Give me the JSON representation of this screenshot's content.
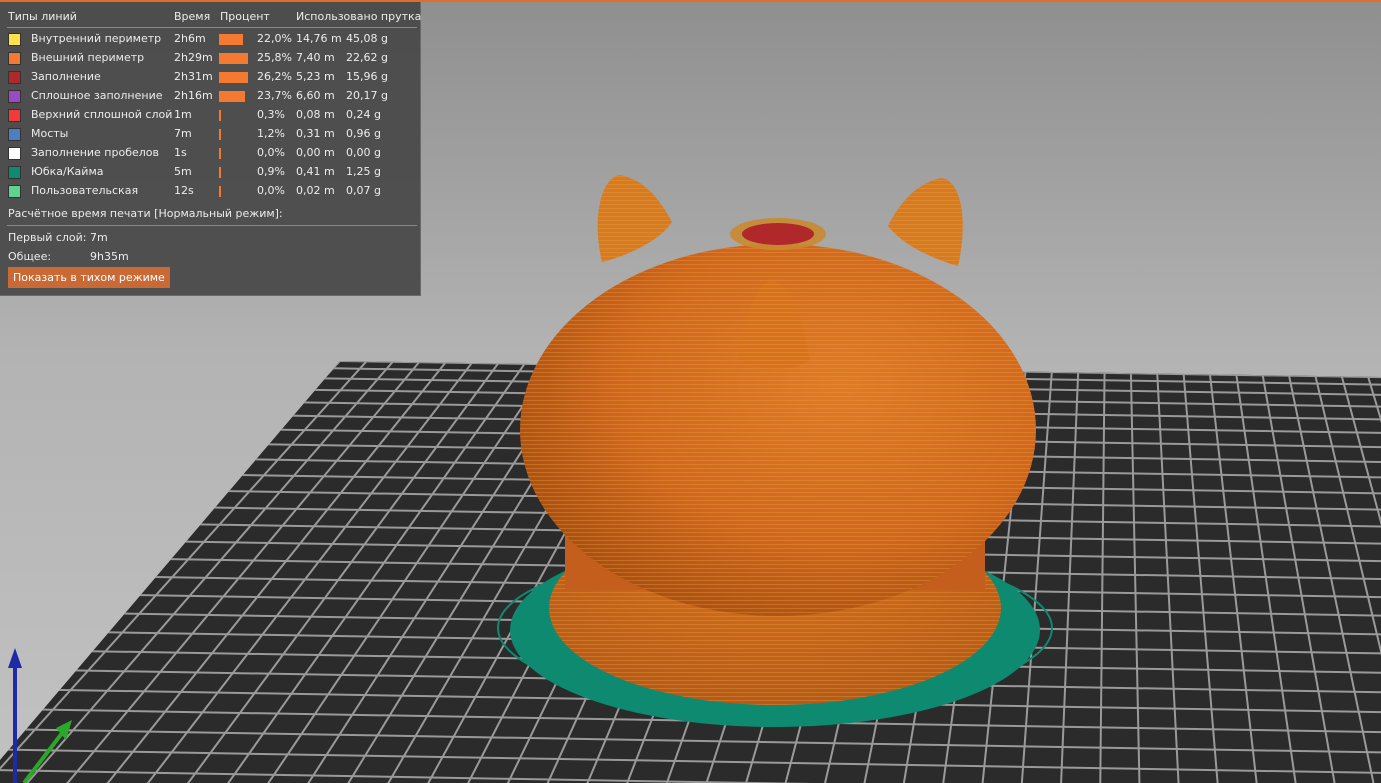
{
  "legend": {
    "headers": {
      "type": "Типы линий",
      "time": "Время",
      "percent": "Процент",
      "used": "Использовано прутка"
    },
    "rows": [
      {
        "label": "Внутренний периметр",
        "color": "#ffe14a",
        "time": "2h6m",
        "percent": "22,0%",
        "pct": 22.0,
        "length": "14,76 m",
        "weight": "45,08 g"
      },
      {
        "label": "Внешний периметр",
        "color": "#f47a32",
        "time": "2h29m",
        "percent": "25,8%",
        "pct": 25.8,
        "length": "7,40 m",
        "weight": "22,62 g"
      },
      {
        "label": "Заполнение",
        "color": "#b0282a",
        "time": "2h31m",
        "percent": "26,2%",
        "pct": 26.2,
        "length": "5,23 m",
        "weight": "15,96 g"
      },
      {
        "label": "Сплошное заполнение",
        "color": "#9a4bc4",
        "time": "2h16m",
        "percent": "23,7%",
        "pct": 23.7,
        "length": "6,60 m",
        "weight": "20,17 g"
      },
      {
        "label": "Верхний сплошной слой",
        "color": "#f23a3a",
        "time": "1m",
        "percent": "0,3%",
        "pct": 0.3,
        "length": "0,08 m",
        "weight": "0,24 g"
      },
      {
        "label": "Мосты",
        "color": "#4b7fc2",
        "time": "7m",
        "percent": "1,2%",
        "pct": 1.2,
        "length": "0,31 m",
        "weight": "0,96 g"
      },
      {
        "label": "Заполнение пробелов",
        "color": "#ffffff",
        "time": "1s",
        "percent": "0,0%",
        "pct": 0.0,
        "length": "0,00 m",
        "weight": "0,00 g"
      },
      {
        "label": "Юбка/Кайма",
        "color": "#0e8a70",
        "time": "5m",
        "percent": "0,9%",
        "pct": 0.9,
        "length": "0,41 m",
        "weight": "1,25 g"
      },
      {
        "label": "Пользовательская",
        "color": "#5ed28f",
        "time": "12s",
        "percent": "0,0%",
        "pct": 0.0,
        "length": "0,02 m",
        "weight": "0,07 g"
      }
    ],
    "estimate_title": "Расчётное время печати [Нормальный режим]:",
    "first_layer_label": "Первый слой:",
    "first_layer_value": "7m",
    "total_label": "Общее:",
    "total_value": "9h35m",
    "quiet_button": "Показать в тихом режиме"
  },
  "colors": {
    "accent": "#e36c2b",
    "model": "#d2661f",
    "skirt": "#0e8a70",
    "top_layer": "#b0282a"
  }
}
